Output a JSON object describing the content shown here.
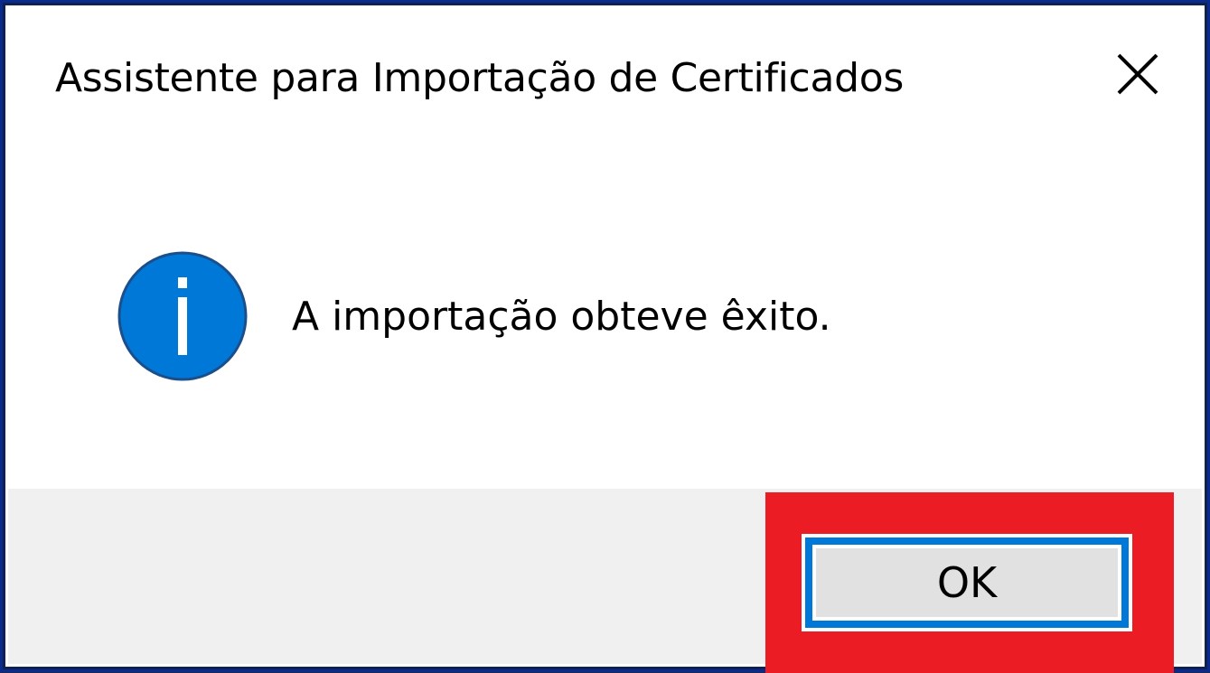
{
  "dialog": {
    "title": "Assistente para Importação de Certificados",
    "message": "A importação obteve êxito.",
    "ok_label": "OK"
  },
  "icons": {
    "close": "close-icon",
    "info": "info-icon"
  },
  "colors": {
    "accent": "#0078d7",
    "highlight": "#ec1c24",
    "footer_bg": "#f0f0f0",
    "window_border": "#0a2a8c"
  }
}
